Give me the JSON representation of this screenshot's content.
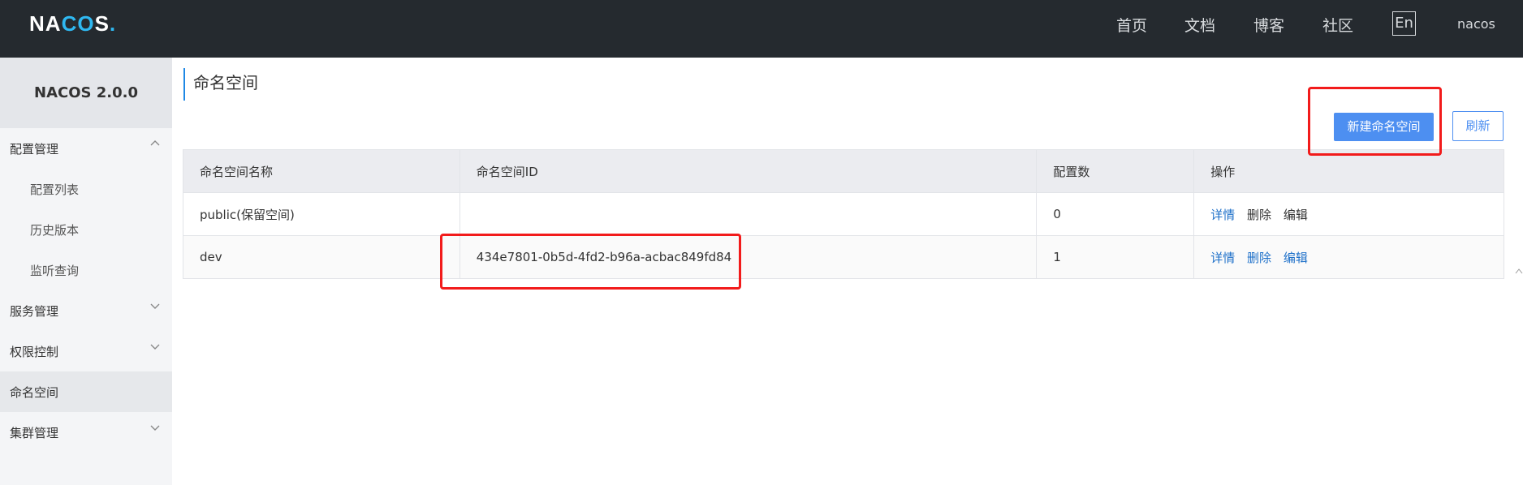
{
  "header": {
    "logo": {
      "left": "NA",
      "mid": "CO",
      "right": "S",
      "dot": "."
    },
    "nav": [
      "首页",
      "文档",
      "博客",
      "社区"
    ],
    "lang": "En",
    "user": "nacos"
  },
  "sidebar": {
    "version": "NACOS 2.0.0",
    "items": [
      {
        "label": "配置管理"
      },
      {
        "label": "配置列表"
      },
      {
        "label": "历史版本"
      },
      {
        "label": "监听查询"
      },
      {
        "label": "服务管理"
      },
      {
        "label": "权限控制"
      },
      {
        "label": "命名空间"
      },
      {
        "label": "集群管理"
      }
    ]
  },
  "main": {
    "title": "命名空间",
    "new_button": "新建命名空间",
    "refresh_button": "刷新",
    "table": {
      "columns": [
        "命名空间名称",
        "命名空间ID",
        "配置数",
        "操作"
      ],
      "rows": [
        {
          "name": "public(保留空间)",
          "id": "",
          "count": "0",
          "ops": [
            "详情",
            "删除",
            "编辑"
          ]
        },
        {
          "name": "dev",
          "id": "434e7801-0b5d-4fd2-b96a-acbac849fd84",
          "count": "1",
          "ops": [
            "详情",
            "删除",
            "编辑"
          ]
        }
      ]
    }
  },
  "colors": {
    "header_bg": "#252a2f",
    "primary": "#4d8ff1",
    "highlight": "#f21b1b",
    "link": "#1e70c9"
  }
}
